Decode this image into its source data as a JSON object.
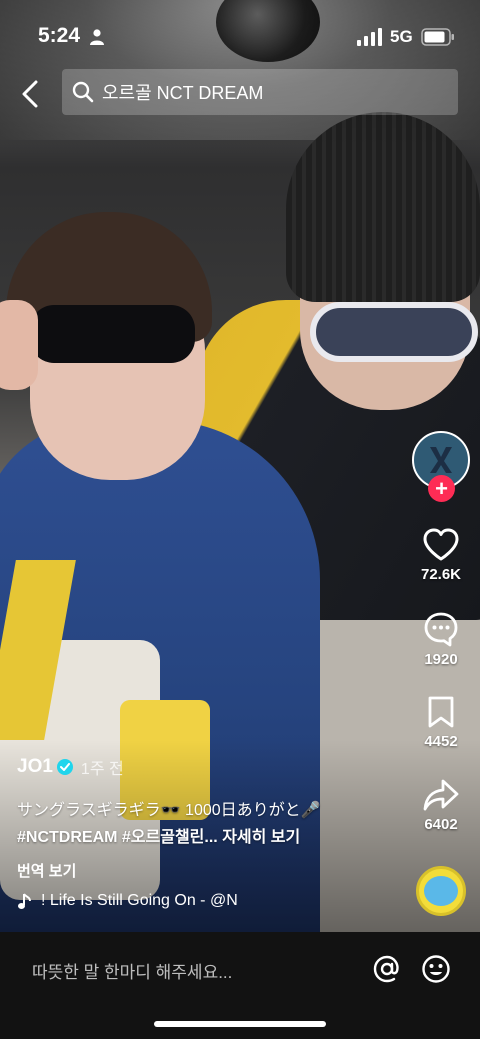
{
  "status_bar": {
    "time": "5:24",
    "network": "5G"
  },
  "search": {
    "query": "오르골 NCT DREAM"
  },
  "rail": {
    "likes": "72.6K",
    "comments": "1920",
    "saves": "4452",
    "shares": "6402",
    "follow_symbol": "+"
  },
  "post": {
    "author": "JO1",
    "time_ago": "1주 전",
    "caption_line1": "サングラスギラギラ🕶️ 1000日ありがと🎤",
    "caption_tags": "#NCTDREAM #오르골챌린...",
    "caption_more": "자세히 보기",
    "translate": "번역 보기",
    "music": "! Life Is Still Going On - @N"
  },
  "comment_bar": {
    "placeholder": "따뜻한 말 한마디 해주세요..."
  },
  "colors": {
    "follow_red": "#fe2c55",
    "verified_blue": "#20d5ec",
    "comment_bar_bg": "#121212"
  },
  "icons": [
    "person-icon",
    "signal-icon",
    "battery-icon",
    "back-arrow-icon",
    "search-icon",
    "heart-icon",
    "comment-icon",
    "bookmark-icon",
    "share-icon",
    "music-note-icon",
    "at-icon",
    "emoji-icon",
    "verified-icon"
  ]
}
